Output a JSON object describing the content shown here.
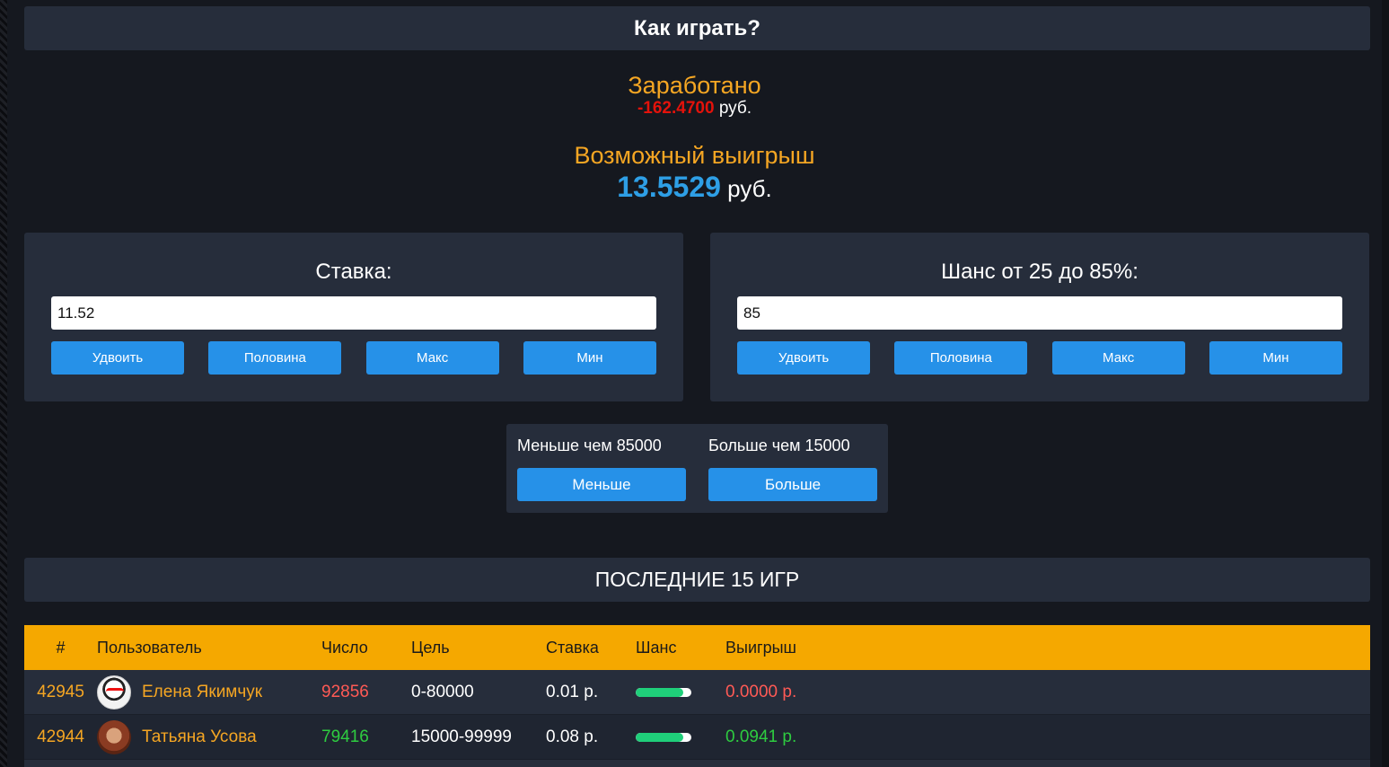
{
  "header": {
    "howto_label": "Как играть?"
  },
  "stats": {
    "earned_label": "Заработано",
    "earned_value": "-162.4700",
    "earned_currency": "руб.",
    "win_label": "Возможный выигрыш",
    "win_value": "13.5529",
    "win_currency": "руб."
  },
  "bet_card": {
    "title": "Ставка:",
    "value": "11.52",
    "buttons": [
      "Удвоить",
      "Половина",
      "Макс",
      "Мин"
    ]
  },
  "chance_card": {
    "title": "Шанс от 25 до 85%:",
    "value": "85",
    "buttons": [
      "Удвоить",
      "Половина",
      "Макс",
      "Мин"
    ]
  },
  "play": {
    "lower_label": "Меньше чем 85000",
    "lower_button": "Меньше",
    "higher_label": "Больше чем 15000",
    "higher_button": "Больше"
  },
  "history": {
    "title": "ПОСЛЕДНИЕ 15 ИГР",
    "columns": [
      "#",
      "Пользователь",
      "Число",
      "Цель",
      "Ставка",
      "Шанс",
      "Выигрыш"
    ],
    "rows": [
      {
        "id": "42945",
        "user": "Елена Якимчук",
        "number": "92856",
        "target": "0-80000",
        "bet": "0.01 р.",
        "chance": 0.85,
        "win": "0.0000 р.",
        "result": "loss"
      },
      {
        "id": "42944",
        "user": "Татьяна Усова",
        "number": "79416",
        "target": "15000-99999",
        "bet": "0.08 р.",
        "chance": 0.85,
        "win": "0.0941 р.",
        "result": "win"
      }
    ]
  },
  "colors": {
    "background": "#15181f",
    "panel": "#262d3b",
    "accent_orange": "#f5a623",
    "button_blue": "#2691e8",
    "value_blue": "#2e9fe6",
    "loss_red": "#ff5a55",
    "win_green": "#2ecc40"
  }
}
